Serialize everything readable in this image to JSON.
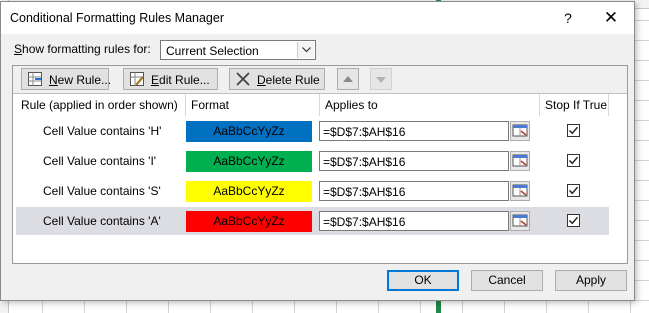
{
  "dialog": {
    "title": "Conditional Formatting Rules Manager",
    "help_label": "?",
    "close_label": "✕"
  },
  "scope": {
    "label_prefix": "",
    "label_underlined": "S",
    "label_rest": "how formatting rules for:",
    "value": "Current Selection"
  },
  "toolbar": {
    "new_rule": {
      "u": "N",
      "rest": "ew Rule..."
    },
    "edit_rule": {
      "u": "E",
      "rest": "dit Rule..."
    },
    "delete_rule": {
      "u": "D",
      "rest": "elete Rule"
    },
    "move_up_icon": "triangle-up",
    "move_down_icon": "triangle-down"
  },
  "columns": {
    "rule": "Rule (applied in order shown)",
    "format": "Format",
    "applies_to": "Applies to",
    "stop_if_true": "Stop If True"
  },
  "rules": [
    {
      "name": "Cell Value contains 'H'",
      "preview": "AaBbCcYyZz",
      "color": "#0070c0",
      "applies_to": "=$D$7:$AH$16",
      "stop_if_true": true,
      "selected": false
    },
    {
      "name": "Cell Value contains 'I'",
      "preview": "AaBbCcYyZz",
      "color": "#00b050",
      "applies_to": "=$D$7:$AH$16",
      "stop_if_true": true,
      "selected": false
    },
    {
      "name": "Cell Value contains 'S'",
      "preview": "AaBbCcYyZz",
      "color": "#ffff00",
      "applies_to": "=$D$7:$AH$16",
      "stop_if_true": true,
      "selected": false
    },
    {
      "name": "Cell Value contains 'A'",
      "preview": "AaBbCcYyZz",
      "color": "#ff0000",
      "applies_to": "=$D$7:$AH$16",
      "stop_if_true": true,
      "selected": true
    }
  ],
  "footer": {
    "ok": "OK",
    "cancel": "Cancel",
    "apply": "Apply"
  },
  "colors": {
    "selection_row": "#dcdce3",
    "accent_focus": "#0078d7"
  }
}
